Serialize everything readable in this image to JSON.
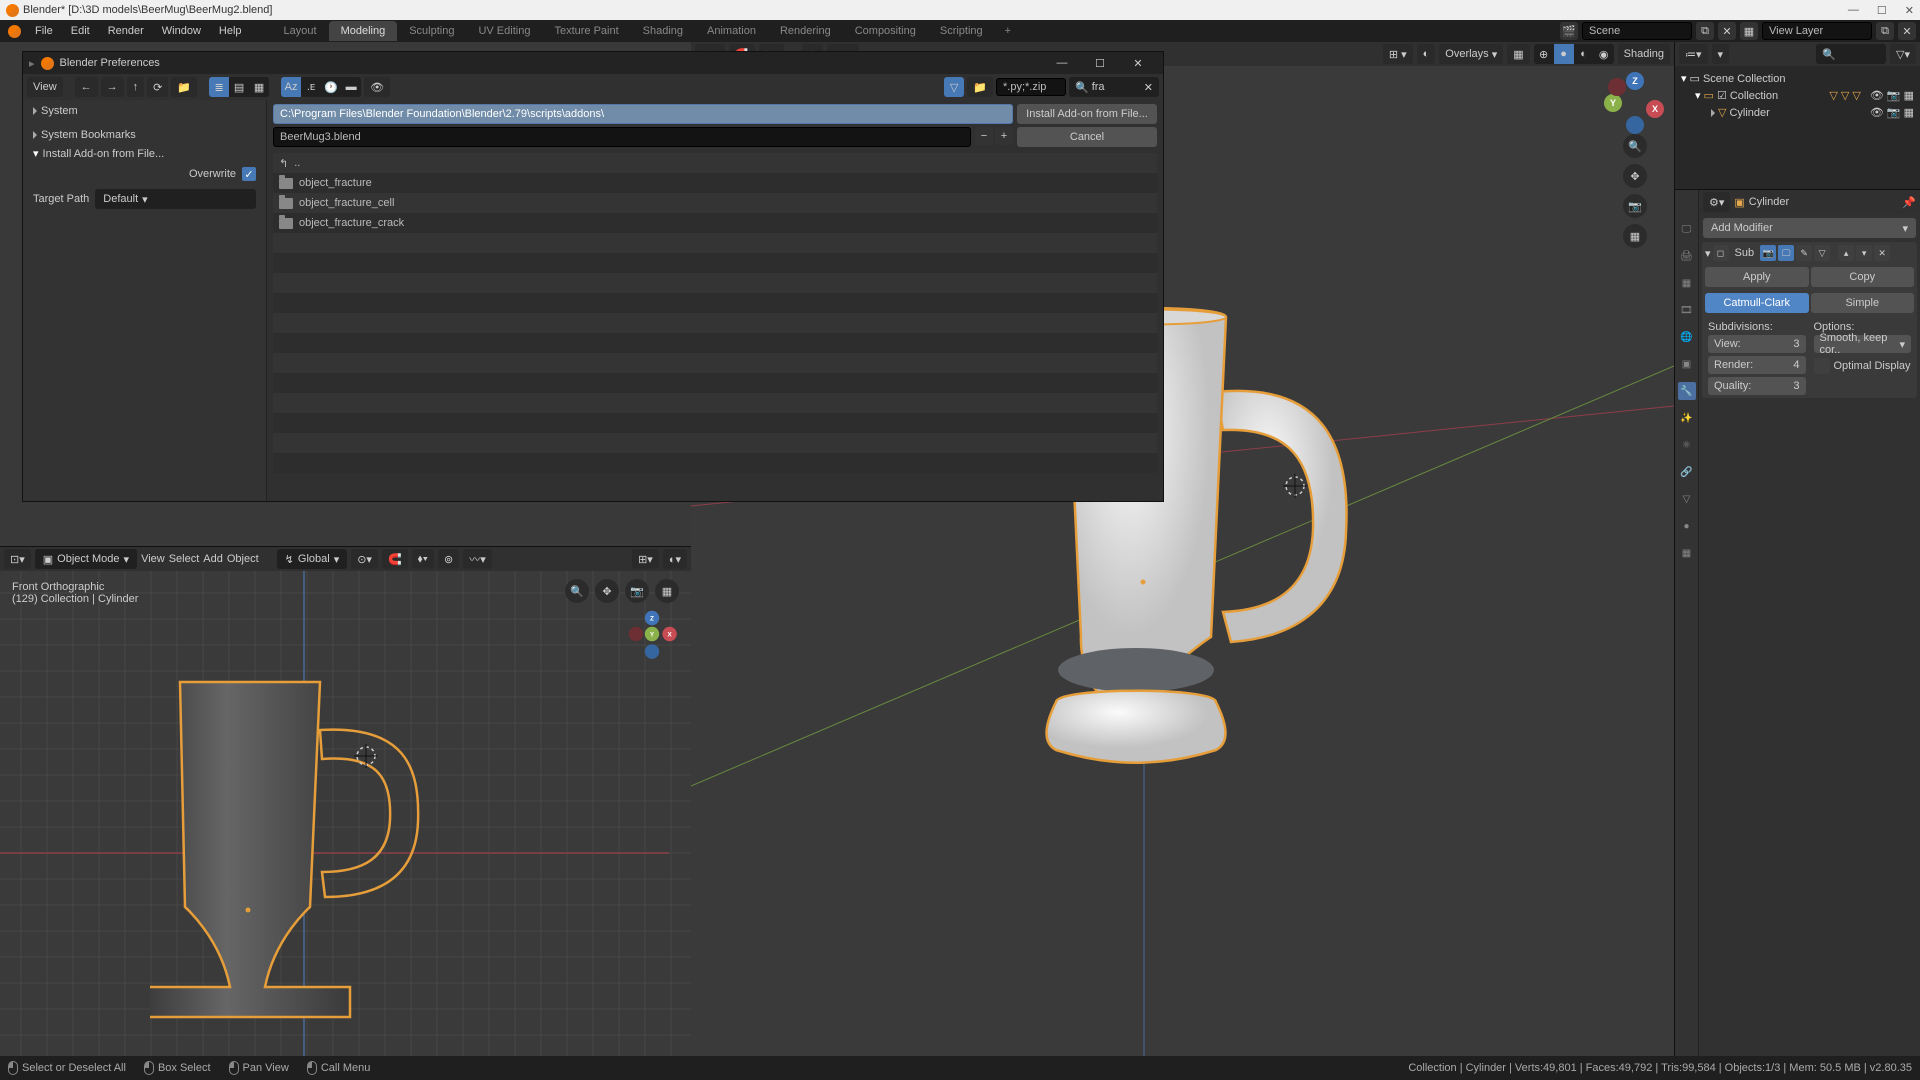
{
  "titlebar": {
    "caption": "Blender* [D:\\3D models\\BeerMug\\BeerMug2.blend]"
  },
  "topmenu": {
    "items": [
      "File",
      "Edit",
      "Render",
      "Window",
      "Help"
    ],
    "workspaces": [
      "Layout",
      "Modeling",
      "Sculpting",
      "UV Editing",
      "Texture Paint",
      "Shading",
      "Animation",
      "Rendering",
      "Compositing",
      "Scripting"
    ],
    "active_workspace": 1,
    "scene_label": "Scene",
    "viewlayer_label": "View Layer"
  },
  "dialog": {
    "title": "Blender Preferences",
    "sidebar": {
      "system": "System",
      "bookmarks": "System Bookmarks",
      "install": "Install Add-on from File...",
      "overwrite_label": "Overwrite",
      "target_label": "Target Path",
      "target_value": "Default"
    },
    "toolbar": {
      "view": "View",
      "filter": "*.py;*.zip",
      "search": "fra"
    },
    "path": "C:\\Program Files\\Blender Foundation\\Blender\\2.79\\scripts\\addons\\",
    "filename": "BeerMug3.blend",
    "btn_install": "Install Add-on from File...",
    "btn_cancel": "Cancel",
    "files": [
      "..",
      "object_fracture",
      "object_fracture_cell",
      "object_fracture_crack"
    ]
  },
  "viewport_left": {
    "mode": "Object Mode",
    "menus": [
      "View",
      "Select",
      "Add",
      "Object"
    ],
    "orient": "Global",
    "info_line1": "Front Orthographic",
    "info_line2": "(129) Collection | Cylinder"
  },
  "viewport_main": {
    "overlays": "Overlays",
    "shading": "Shading"
  },
  "outliner": {
    "root": "Scene Collection",
    "collection": "Collection",
    "object": "Cylinder"
  },
  "properties": {
    "object_name": "Cylinder",
    "add_modifier": "Add Modifier",
    "modifier": {
      "name": "Sub",
      "btn_apply": "Apply",
      "btn_copy": "Copy",
      "type_catmull": "Catmull-Clark",
      "type_simple": "Simple",
      "subdiv_label": "Subdivisions:",
      "options_label": "Options:",
      "view_label": "View:",
      "view_val": "3",
      "render_label": "Render:",
      "render_val": "4",
      "quality_label": "Quality:",
      "quality_val": "3",
      "uv_smooth": "Smooth, keep cor..",
      "optimal": "Optimal Display"
    }
  },
  "status": {
    "lmb": "Select or Deselect All",
    "mmb": "Box Select",
    "rmb_alt": "Pan View",
    "rmb": "Call Menu",
    "right": "Collection | Cylinder | Verts:49,801 | Faces:49,792 | Tris:99,584 | Objects:1/3 | Mem: 50.5 MB | v2.80.35"
  }
}
